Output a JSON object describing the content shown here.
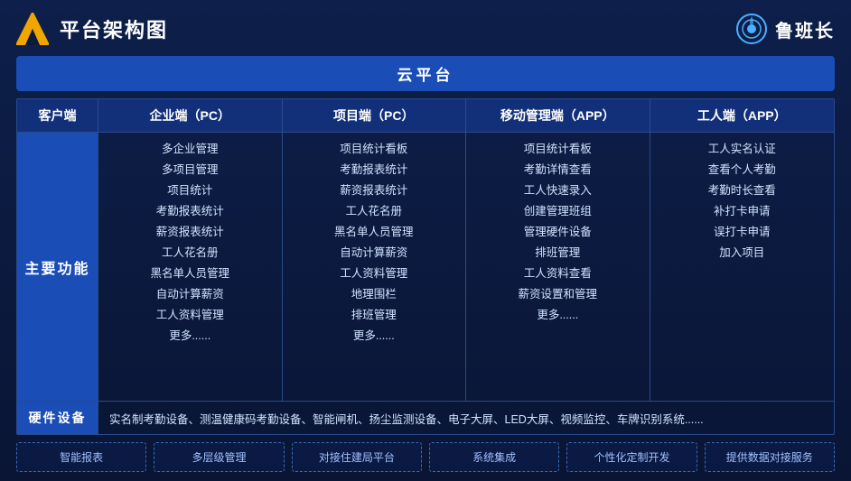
{
  "header": {
    "title": "平台架构图",
    "brand_name": "鲁班长"
  },
  "cloud_bar": {
    "label": "云平台"
  },
  "col_headers": {
    "col0": "客户端",
    "col1": "企业端（PC）",
    "col2": "项目端（PC）",
    "col3": "移动管理端（APP）",
    "col4": "工人端（APP）"
  },
  "main_row_label": "主要功能",
  "enterprise_features": [
    "多企业管理",
    "多项目管理",
    "项目统计",
    "考勤报表统计",
    "薪资报表统计",
    "工人花名册",
    "黑名单人员管理",
    "自动计算薪资",
    "工人资料管理",
    "更多......"
  ],
  "project_features": [
    "项目统计看板",
    "考勤报表统计",
    "薪资报表统计",
    "工人花名册",
    "黑名单人员管理",
    "自动计算薪资",
    "工人资料管理",
    "地理围栏",
    "排班管理",
    "更多......"
  ],
  "mobile_features": [
    "项目统计看板",
    "考勤详情查看",
    "工人快速录入",
    "创建管理班组",
    "管理硬件设备",
    "排班管理",
    "工人资料查看",
    "薪资设置和管理",
    "更多......"
  ],
  "worker_features": [
    "工人实名认证",
    "查看个人考勤",
    "考勤时长查看",
    "补打卡申请",
    "误打卡申请",
    "加入项目"
  ],
  "hardware": {
    "label": "硬件设备",
    "content": "实名制考勤设备、测温健康码考勤设备、智能闸机、扬尘监测设备、电子大屏、LED大屏、视频监控、车牌识别系统......"
  },
  "bottom_tags": [
    "智能报表",
    "多层级管理",
    "对接住建局平台",
    "系统集成",
    "个性化定制开发",
    "提供数据对接服务"
  ]
}
